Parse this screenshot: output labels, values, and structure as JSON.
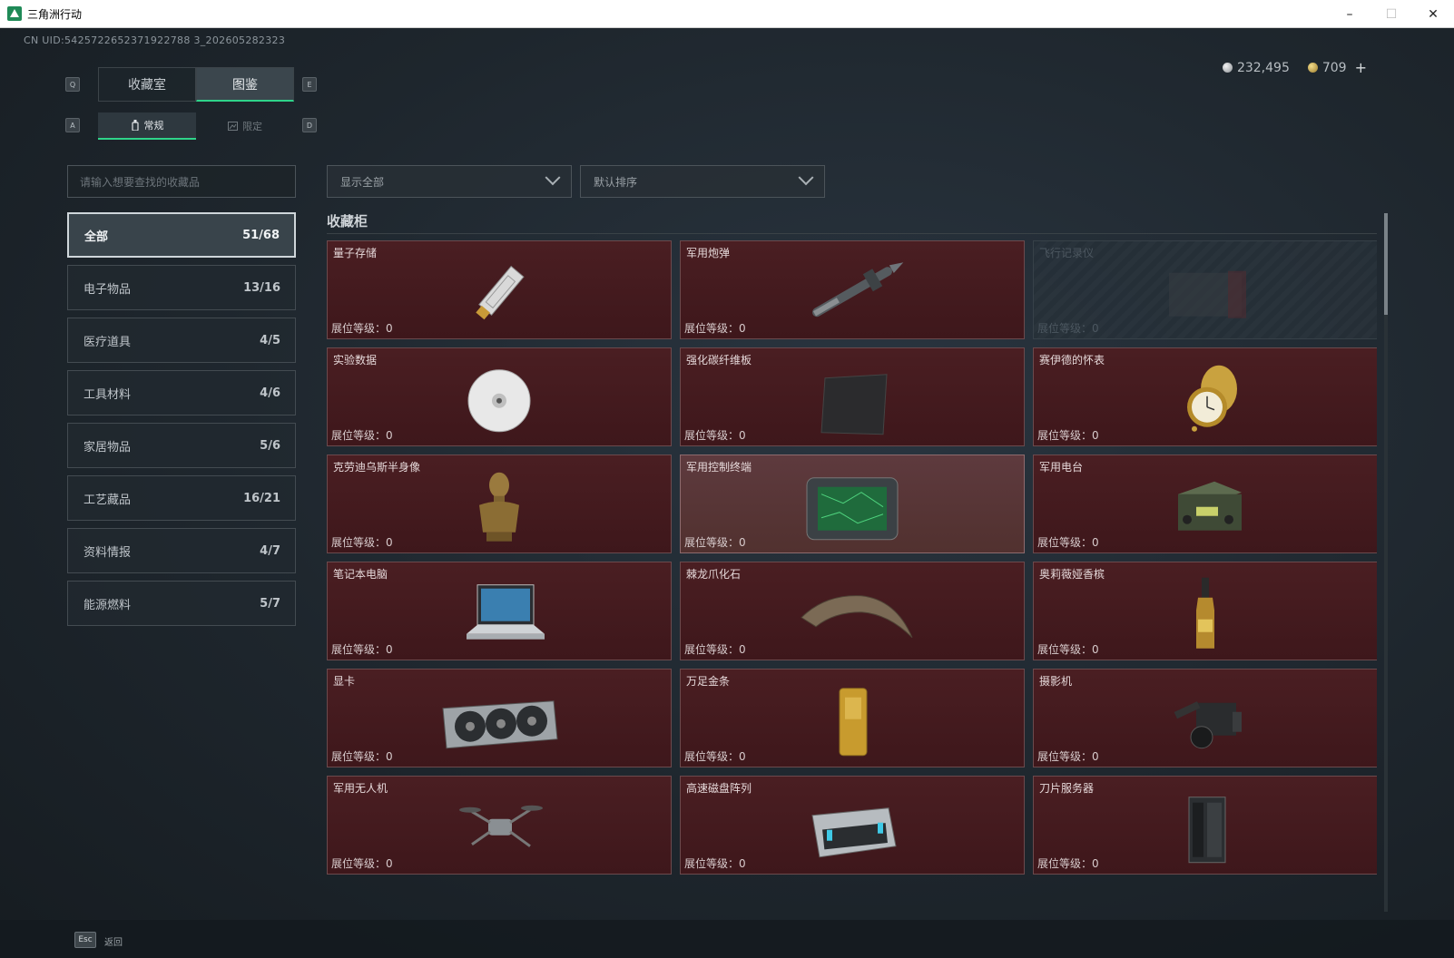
{
  "window": {
    "title": "三角洲行动",
    "min": "–",
    "max": "☐",
    "close": "✕"
  },
  "uid": "CN UID:5425722652371922788 3_202605282323",
  "currency": {
    "silver": "232,495",
    "gold": "709",
    "plus": "+"
  },
  "keys": {
    "q": "Q",
    "e": "E",
    "a": "A",
    "d": "D"
  },
  "tabs_main": [
    {
      "label": "收藏室"
    },
    {
      "label": "图鉴"
    }
  ],
  "tabs_sub": [
    {
      "label": "常规"
    },
    {
      "label": "限定"
    }
  ],
  "search": {
    "placeholder": "请输入想要查找的收藏品"
  },
  "filters": {
    "display": "显示全部",
    "sort": "默认排序"
  },
  "categories": [
    {
      "label": "全部",
      "count": "51/68"
    },
    {
      "label": "电子物品",
      "count": "13/16"
    },
    {
      "label": "医疗道具",
      "count": "4/5"
    },
    {
      "label": "工具材料",
      "count": "4/6"
    },
    {
      "label": "家居物品",
      "count": "5/6"
    },
    {
      "label": "工艺藏品",
      "count": "16/21"
    },
    {
      "label": "资料情报",
      "count": "4/7"
    },
    {
      "label": "能源燃料",
      "count": "5/7"
    }
  ],
  "section_title": "收藏柜",
  "level_label": "展位等级：",
  "items": [
    {
      "name": "量子存储",
      "level": "0",
      "icon": "quantum-storage-icon"
    },
    {
      "name": "军用炮弹",
      "level": "0",
      "icon": "shell-icon"
    },
    {
      "name": "飞行记录仪",
      "level": "0",
      "icon": "flight-recorder-icon"
    },
    {
      "name": "实验数据",
      "level": "0",
      "icon": "disc-icon"
    },
    {
      "name": "强化碳纤维板",
      "level": "0",
      "icon": "carbon-plate-icon"
    },
    {
      "name": "赛伊德的怀表",
      "level": "0",
      "icon": "pocket-watch-icon"
    },
    {
      "name": "克劳迪乌斯半身像",
      "level": "0",
      "icon": "bust-icon"
    },
    {
      "name": "军用控制终端",
      "level": "0",
      "icon": "terminal-icon"
    },
    {
      "name": "军用电台",
      "level": "0",
      "icon": "radio-icon"
    },
    {
      "name": "笔记本电脑",
      "level": "0",
      "icon": "laptop-icon"
    },
    {
      "name": "棘龙爪化石",
      "level": "0",
      "icon": "claw-fossil-icon"
    },
    {
      "name": "奥莉薇娅香槟",
      "level": "0",
      "icon": "champagne-icon"
    },
    {
      "name": "显卡",
      "level": "0",
      "icon": "gpu-icon"
    },
    {
      "name": "万足金条",
      "level": "0",
      "icon": "gold-bar-icon"
    },
    {
      "name": "摄影机",
      "level": "0",
      "icon": "camera-icon"
    },
    {
      "name": "军用无人机",
      "level": "0",
      "icon": "drone-icon"
    },
    {
      "name": "高速磁盘阵列",
      "level": "0",
      "icon": "disk-array-icon"
    },
    {
      "name": "刀片服务器",
      "level": "0",
      "icon": "blade-server-icon"
    }
  ],
  "footer": {
    "esc": "Esc",
    "back": "返回"
  }
}
